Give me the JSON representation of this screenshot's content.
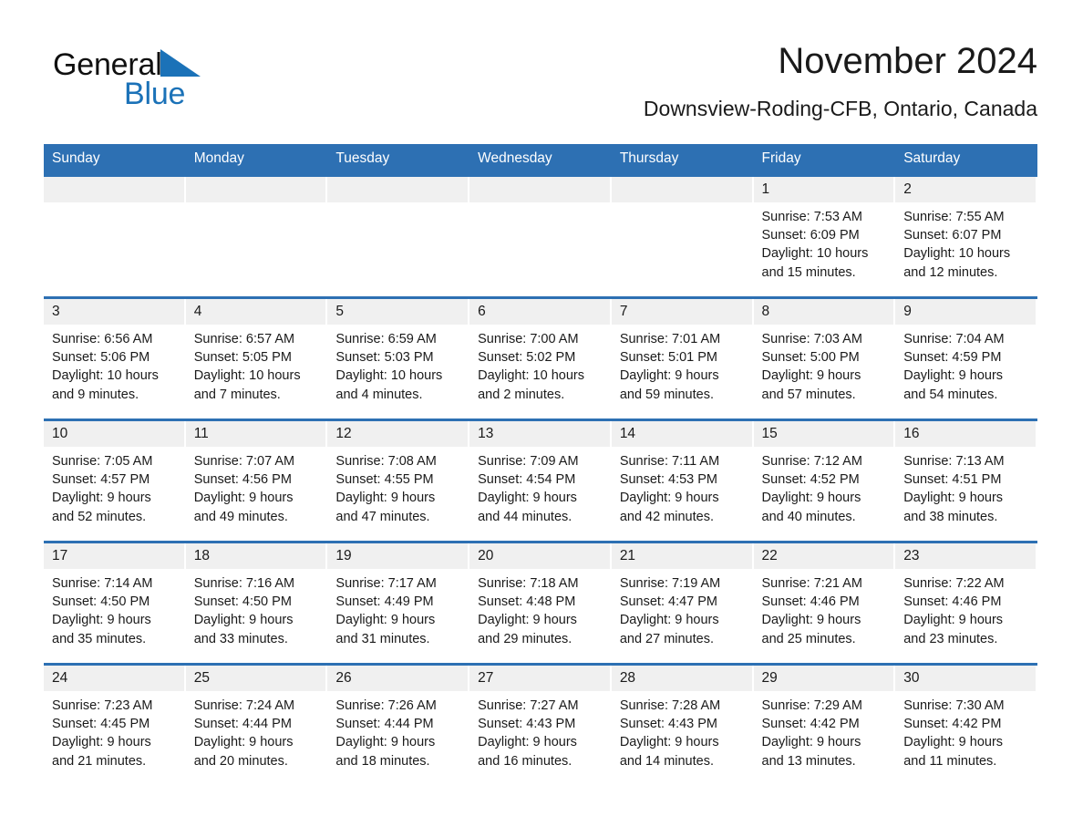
{
  "brand": {
    "name_part1": "General",
    "name_part2": "Blue",
    "triangle_color": "#1b72b8"
  },
  "header": {
    "title": "November 2024",
    "subtitle": "Downsview-Roding-CFB, Ontario, Canada"
  },
  "theme": {
    "header_blue": "#2d70b3",
    "daynum_band": "#f0f0f0",
    "text": "#1a1a1a"
  },
  "weekday_headers": [
    "Sunday",
    "Monday",
    "Tuesday",
    "Wednesday",
    "Thursday",
    "Friday",
    "Saturday"
  ],
  "weeks": [
    [
      {
        "day": "",
        "sunrise": "",
        "sunset": "",
        "daylight_line1": "",
        "daylight_line2": ""
      },
      {
        "day": "",
        "sunrise": "",
        "sunset": "",
        "daylight_line1": "",
        "daylight_line2": ""
      },
      {
        "day": "",
        "sunrise": "",
        "sunset": "",
        "daylight_line1": "",
        "daylight_line2": ""
      },
      {
        "day": "",
        "sunrise": "",
        "sunset": "",
        "daylight_line1": "",
        "daylight_line2": ""
      },
      {
        "day": "",
        "sunrise": "",
        "sunset": "",
        "daylight_line1": "",
        "daylight_line2": ""
      },
      {
        "day": "1",
        "sunrise": "Sunrise: 7:53 AM",
        "sunset": "Sunset: 6:09 PM",
        "daylight_line1": "Daylight: 10 hours",
        "daylight_line2": "and 15 minutes."
      },
      {
        "day": "2",
        "sunrise": "Sunrise: 7:55 AM",
        "sunset": "Sunset: 6:07 PM",
        "daylight_line1": "Daylight: 10 hours",
        "daylight_line2": "and 12 minutes."
      }
    ],
    [
      {
        "day": "3",
        "sunrise": "Sunrise: 6:56 AM",
        "sunset": "Sunset: 5:06 PM",
        "daylight_line1": "Daylight: 10 hours",
        "daylight_line2": "and 9 minutes."
      },
      {
        "day": "4",
        "sunrise": "Sunrise: 6:57 AM",
        "sunset": "Sunset: 5:05 PM",
        "daylight_line1": "Daylight: 10 hours",
        "daylight_line2": "and 7 minutes."
      },
      {
        "day": "5",
        "sunrise": "Sunrise: 6:59 AM",
        "sunset": "Sunset: 5:03 PM",
        "daylight_line1": "Daylight: 10 hours",
        "daylight_line2": "and 4 minutes."
      },
      {
        "day": "6",
        "sunrise": "Sunrise: 7:00 AM",
        "sunset": "Sunset: 5:02 PM",
        "daylight_line1": "Daylight: 10 hours",
        "daylight_line2": "and 2 minutes."
      },
      {
        "day": "7",
        "sunrise": "Sunrise: 7:01 AM",
        "sunset": "Sunset: 5:01 PM",
        "daylight_line1": "Daylight: 9 hours",
        "daylight_line2": "and 59 minutes."
      },
      {
        "day": "8",
        "sunrise": "Sunrise: 7:03 AM",
        "sunset": "Sunset: 5:00 PM",
        "daylight_line1": "Daylight: 9 hours",
        "daylight_line2": "and 57 minutes."
      },
      {
        "day": "9",
        "sunrise": "Sunrise: 7:04 AM",
        "sunset": "Sunset: 4:59 PM",
        "daylight_line1": "Daylight: 9 hours",
        "daylight_line2": "and 54 minutes."
      }
    ],
    [
      {
        "day": "10",
        "sunrise": "Sunrise: 7:05 AM",
        "sunset": "Sunset: 4:57 PM",
        "daylight_line1": "Daylight: 9 hours",
        "daylight_line2": "and 52 minutes."
      },
      {
        "day": "11",
        "sunrise": "Sunrise: 7:07 AM",
        "sunset": "Sunset: 4:56 PM",
        "daylight_line1": "Daylight: 9 hours",
        "daylight_line2": "and 49 minutes."
      },
      {
        "day": "12",
        "sunrise": "Sunrise: 7:08 AM",
        "sunset": "Sunset: 4:55 PM",
        "daylight_line1": "Daylight: 9 hours",
        "daylight_line2": "and 47 minutes."
      },
      {
        "day": "13",
        "sunrise": "Sunrise: 7:09 AM",
        "sunset": "Sunset: 4:54 PM",
        "daylight_line1": "Daylight: 9 hours",
        "daylight_line2": "and 44 minutes."
      },
      {
        "day": "14",
        "sunrise": "Sunrise: 7:11 AM",
        "sunset": "Sunset: 4:53 PM",
        "daylight_line1": "Daylight: 9 hours",
        "daylight_line2": "and 42 minutes."
      },
      {
        "day": "15",
        "sunrise": "Sunrise: 7:12 AM",
        "sunset": "Sunset: 4:52 PM",
        "daylight_line1": "Daylight: 9 hours",
        "daylight_line2": "and 40 minutes."
      },
      {
        "day": "16",
        "sunrise": "Sunrise: 7:13 AM",
        "sunset": "Sunset: 4:51 PM",
        "daylight_line1": "Daylight: 9 hours",
        "daylight_line2": "and 38 minutes."
      }
    ],
    [
      {
        "day": "17",
        "sunrise": "Sunrise: 7:14 AM",
        "sunset": "Sunset: 4:50 PM",
        "daylight_line1": "Daylight: 9 hours",
        "daylight_line2": "and 35 minutes."
      },
      {
        "day": "18",
        "sunrise": "Sunrise: 7:16 AM",
        "sunset": "Sunset: 4:50 PM",
        "daylight_line1": "Daylight: 9 hours",
        "daylight_line2": "and 33 minutes."
      },
      {
        "day": "19",
        "sunrise": "Sunrise: 7:17 AM",
        "sunset": "Sunset: 4:49 PM",
        "daylight_line1": "Daylight: 9 hours",
        "daylight_line2": "and 31 minutes."
      },
      {
        "day": "20",
        "sunrise": "Sunrise: 7:18 AM",
        "sunset": "Sunset: 4:48 PM",
        "daylight_line1": "Daylight: 9 hours",
        "daylight_line2": "and 29 minutes."
      },
      {
        "day": "21",
        "sunrise": "Sunrise: 7:19 AM",
        "sunset": "Sunset: 4:47 PM",
        "daylight_line1": "Daylight: 9 hours",
        "daylight_line2": "and 27 minutes."
      },
      {
        "day": "22",
        "sunrise": "Sunrise: 7:21 AM",
        "sunset": "Sunset: 4:46 PM",
        "daylight_line1": "Daylight: 9 hours",
        "daylight_line2": "and 25 minutes."
      },
      {
        "day": "23",
        "sunrise": "Sunrise: 7:22 AM",
        "sunset": "Sunset: 4:46 PM",
        "daylight_line1": "Daylight: 9 hours",
        "daylight_line2": "and 23 minutes."
      }
    ],
    [
      {
        "day": "24",
        "sunrise": "Sunrise: 7:23 AM",
        "sunset": "Sunset: 4:45 PM",
        "daylight_line1": "Daylight: 9 hours",
        "daylight_line2": "and 21 minutes."
      },
      {
        "day": "25",
        "sunrise": "Sunrise: 7:24 AM",
        "sunset": "Sunset: 4:44 PM",
        "daylight_line1": "Daylight: 9 hours",
        "daylight_line2": "and 20 minutes."
      },
      {
        "day": "26",
        "sunrise": "Sunrise: 7:26 AM",
        "sunset": "Sunset: 4:44 PM",
        "daylight_line1": "Daylight: 9 hours",
        "daylight_line2": "and 18 minutes."
      },
      {
        "day": "27",
        "sunrise": "Sunrise: 7:27 AM",
        "sunset": "Sunset: 4:43 PM",
        "daylight_line1": "Daylight: 9 hours",
        "daylight_line2": "and 16 minutes."
      },
      {
        "day": "28",
        "sunrise": "Sunrise: 7:28 AM",
        "sunset": "Sunset: 4:43 PM",
        "daylight_line1": "Daylight: 9 hours",
        "daylight_line2": "and 14 minutes."
      },
      {
        "day": "29",
        "sunrise": "Sunrise: 7:29 AM",
        "sunset": "Sunset: 4:42 PM",
        "daylight_line1": "Daylight: 9 hours",
        "daylight_line2": "and 13 minutes."
      },
      {
        "day": "30",
        "sunrise": "Sunrise: 7:30 AM",
        "sunset": "Sunset: 4:42 PM",
        "daylight_line1": "Daylight: 9 hours",
        "daylight_line2": "and 11 minutes."
      }
    ]
  ]
}
